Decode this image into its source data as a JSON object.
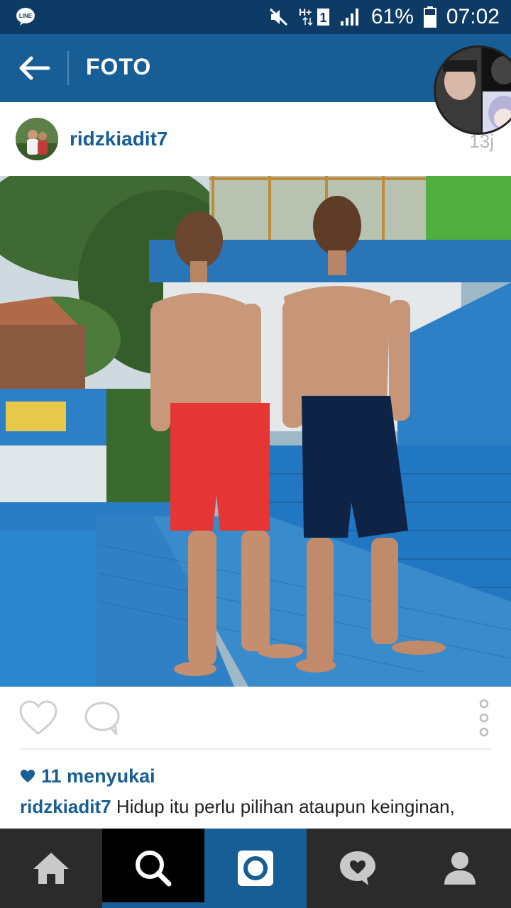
{
  "status_bar": {
    "notification_icon": "line-icon",
    "notification_label": "LINE",
    "mute_icon": "mute-icon",
    "network_label": "H+",
    "sim_label": "1",
    "signal_icon": "signal-icon",
    "battery_percent": "61%",
    "battery_icon": "battery-icon",
    "time": "07:02"
  },
  "app_bar": {
    "back_icon": "back-arrow-icon",
    "title": "FOTO"
  },
  "post": {
    "username": "ridzkiadit7",
    "time_ago": "13j",
    "likes_count": "11 menyukai",
    "caption_user": "ridzkiadit7",
    "caption_text": " Hidup itu perlu pilihan ataupun keinginan,"
  },
  "actions": {
    "like_icon": "heart-outline-icon",
    "comment_icon": "comment-icon",
    "more_icon": "more-vertical-icon"
  },
  "bottom_nav": {
    "items": [
      "home-icon",
      "search-icon",
      "camera-icon",
      "activity-icon",
      "profile-icon"
    ],
    "active": "search-icon"
  },
  "colors": {
    "status_bar": "#0d3b66",
    "app_bar": "#175e97",
    "accent": "#175e97",
    "bottom_nav": "#2b2b2b"
  }
}
